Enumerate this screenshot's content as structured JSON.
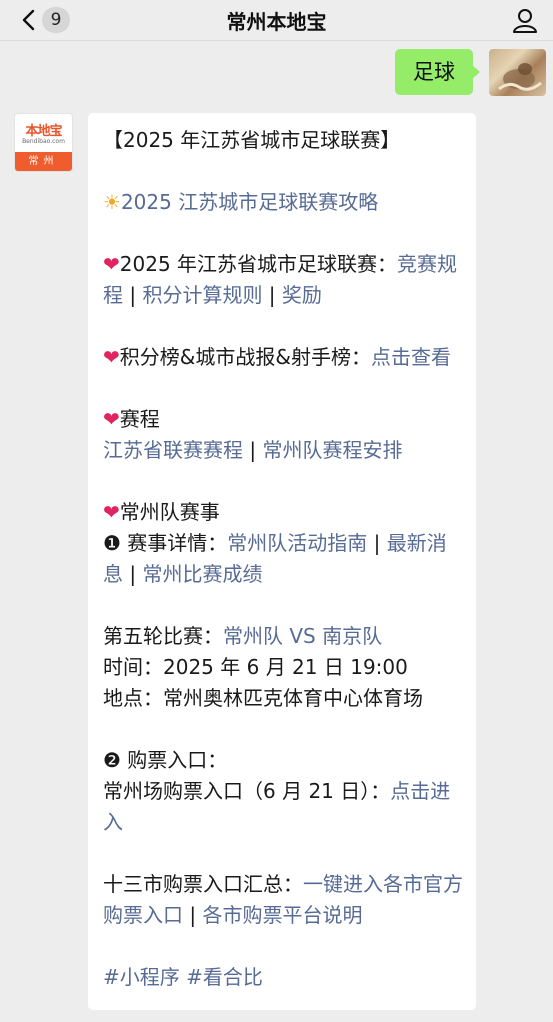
{
  "header": {
    "title": "常州本地宝",
    "unread_count": "9"
  },
  "outgoing": {
    "text": "足球"
  },
  "bot": {
    "logo_text": "本地宝",
    "logo_sub": "Bendibao.com",
    "logo_city": "常州"
  },
  "message": {
    "headline": "【2025 年江苏省城市足球联赛】",
    "guide_icon": "☀",
    "guide_link": "2025 江苏城市足球联赛攻略",
    "heart_icon": "❤",
    "rules_label": "2025 年江苏省城市足球联赛：",
    "rules_link1": "竞赛规程",
    "rules_link2": "积分计算规则",
    "rules_link3": "奖励",
    "sep": " | ",
    "standings_label": "积分榜&城市战报&射手榜：",
    "standings_link": "点击查看",
    "schedule_label": "赛程",
    "schedule_link1": "江苏省联赛赛程",
    "schedule_link2": "常州队赛程安排",
    "events_label": "常州队赛事",
    "detail_prefix": "❶ 赛事详情：",
    "detail_link1": "常州队活动指南",
    "detail_link2": "最新消息",
    "detail_link3": "常州比赛成绩",
    "round_label": "第五轮比赛：",
    "round_link": "常州队 VS 南京队",
    "time_line": "时间：2025 年 6 月 21 日 19:00",
    "place_line": "地点：常州奥林匹克体育中心体育场",
    "ticket_label": "❷ 购票入口：",
    "ticket_home_label": "常州场购票入口（6 月 21 日）：",
    "ticket_home_link": "点击进入",
    "thirteen_label": "十三市购票入口汇总：",
    "thirteen_link1": "一键进入各市官方购票入口",
    "thirteen_link2": "各市购票平台说明",
    "cut_line": "#小程序 #看合比"
  }
}
